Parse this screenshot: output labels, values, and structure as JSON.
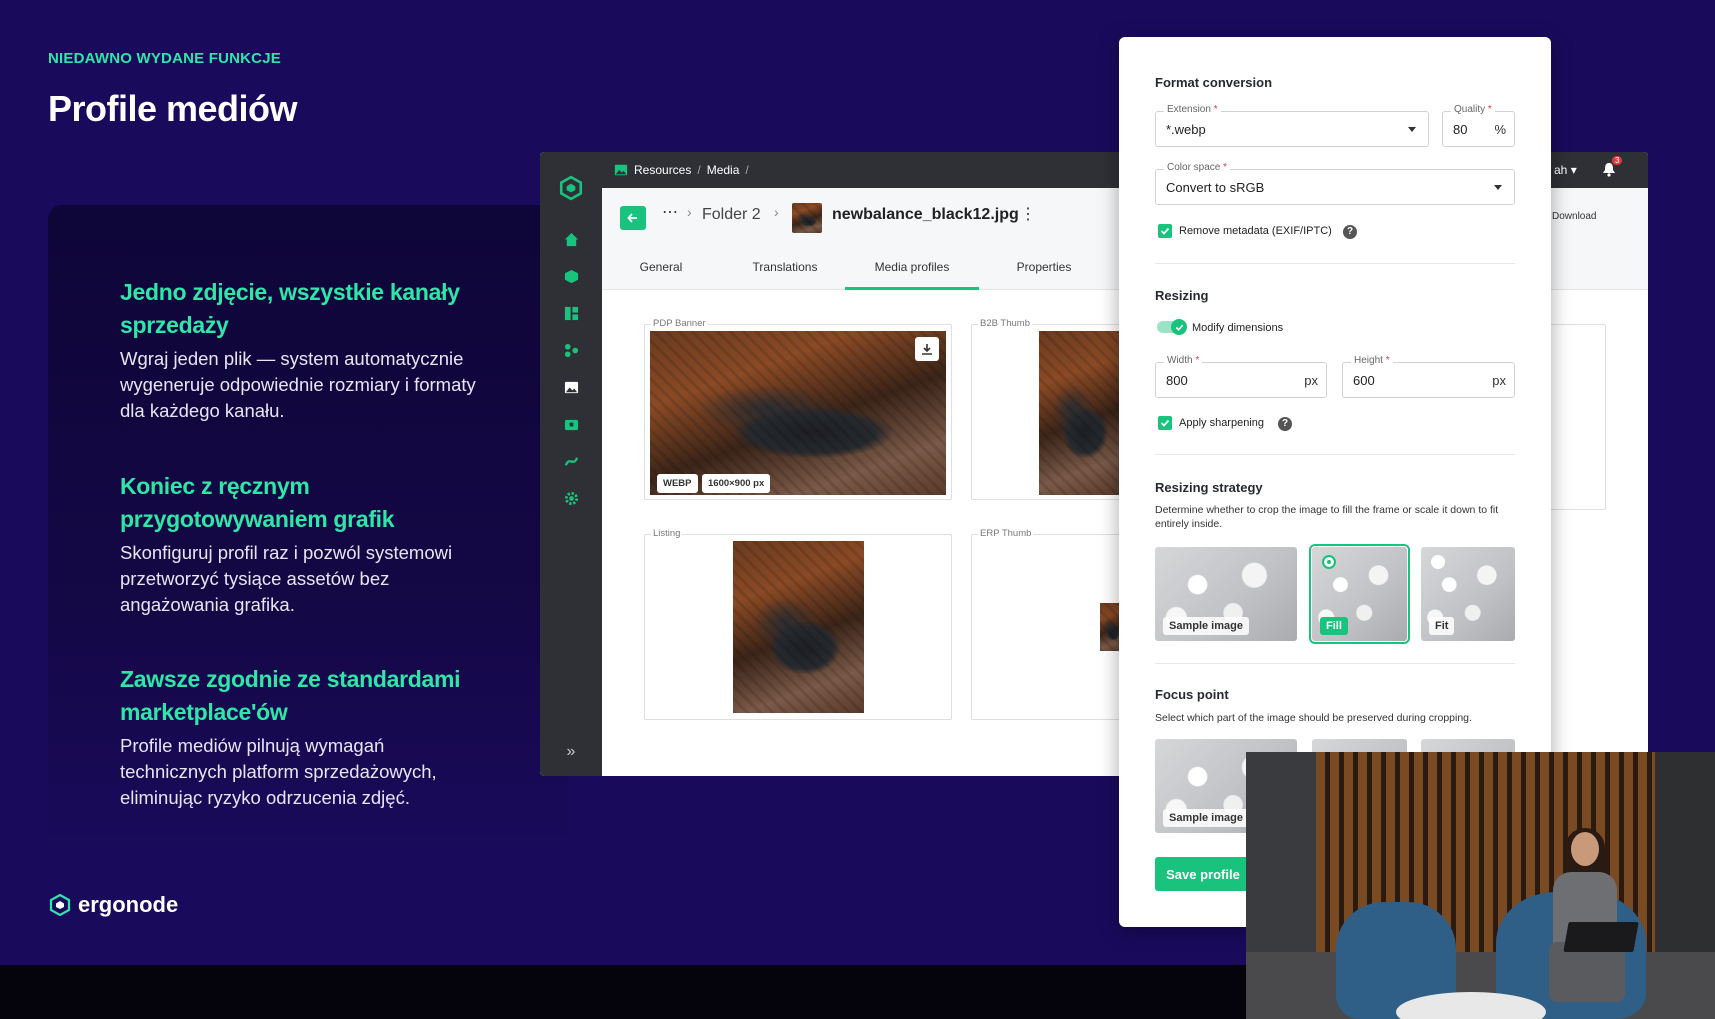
{
  "slide": {
    "eyebrow": "NIEDAWNO WYDANE FUNKCJE",
    "title": "Profile mediów",
    "features": [
      {
        "heading": "Jedno zdjęcie, wszystkie kanały sprzedaży",
        "body": "Wgraj jeden plik — system automatycznie wygeneruje odpowiednie rozmiary i formaty dla każdego kanału."
      },
      {
        "heading": "Koniec z ręcznym przygotowywaniem grafik",
        "body": "Skonfiguruj profil raz i pozwól systemowi przetworzyć tysiące assetów bez angażowania grafika."
      },
      {
        "heading": "Zawsze zgodnie ze standardami marketplace'ów",
        "body": "Profile mediów pilnują wymagań technicznych platform sprzedażowych, eliminując ryzyko odrzucenia zdjęć."
      }
    ],
    "logo_text": "ergonode"
  },
  "app": {
    "breadcrumb": [
      "Resources",
      "Media"
    ],
    "user_fragment": "ah",
    "notification_count": "3",
    "folder": "Folder 2",
    "filename": "newbalance_black12.jpg",
    "download_label": "Download",
    "tabs": [
      "General",
      "Translations",
      "Media profiles",
      "Properties"
    ],
    "active_tab": "Media profiles",
    "media_boxes": {
      "pdp_banner": "PDP Banner",
      "b2b_thumb": "B2B Thumb",
      "listing": "Listing",
      "erp_thumb": "ERP Thumb"
    },
    "pdp_tags": [
      "WEBP",
      "1600×900 px"
    ]
  },
  "panel": {
    "format_conversion": {
      "title": "Format conversion",
      "extension_label": "Extension",
      "extension_value": "*.webp",
      "quality_label": "Quality",
      "quality_value": "80",
      "quality_suffix": "%",
      "color_space_label": "Color space",
      "color_space_value": "Convert to sRGB",
      "remove_metadata_label": "Remove metadata (EXIF/IPTC)",
      "remove_metadata_checked": true
    },
    "resizing": {
      "title": "Resizing",
      "modify_dimensions_label": "Modify dimensions",
      "modify_dimensions_on": true,
      "width_label": "Width",
      "width_value": "800",
      "height_label": "Height",
      "height_value": "600",
      "unit": "px",
      "apply_sharpening_label": "Apply sharpening",
      "apply_sharpening_checked": true
    },
    "resizing_strategy": {
      "title": "Resizing strategy",
      "description": "Determine whether to crop the image to fill the frame or scale it down to fit entirely inside.",
      "options": [
        "Sample image",
        "Fill",
        "Fit"
      ],
      "selected": "Fill"
    },
    "focus_point": {
      "title": "Focus point",
      "description": "Select which part of the image should be preserved during cropping.",
      "sample_label": "Sample image"
    },
    "save_label": "Save profile"
  },
  "colors": {
    "background": "#1a0a5c",
    "accent": "#2ee6a8",
    "app_green": "#19c37d",
    "sidebar": "#2e3036"
  }
}
